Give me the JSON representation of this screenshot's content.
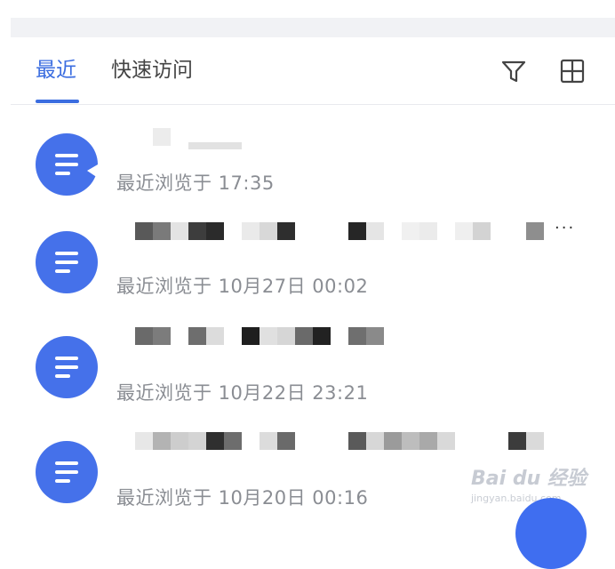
{
  "tabs": [
    {
      "label": "最近",
      "active": true
    },
    {
      "label": "快速访问",
      "active": false
    }
  ],
  "toolbar": {
    "filter_icon": "filter-icon",
    "grid_icon": "grid-view-icon"
  },
  "files": [
    {
      "subtitle": "最近浏览于 17:35",
      "has_more": false
    },
    {
      "subtitle": "最近浏览于 10月27日 00:02",
      "has_more": true,
      "more_label": "···"
    },
    {
      "subtitle": "最近浏览于 10月22日 23:21",
      "has_more": false
    },
    {
      "subtitle": "最近浏览于 10月20日 00:16",
      "has_more": false
    }
  ],
  "watermark": {
    "text": "Bai du 经验",
    "sub": "jingyan.baidu.com"
  },
  "colors": {
    "accent": "#3b6de0",
    "icon_bg": "#4571ea",
    "subtitle": "#8a8d93"
  }
}
